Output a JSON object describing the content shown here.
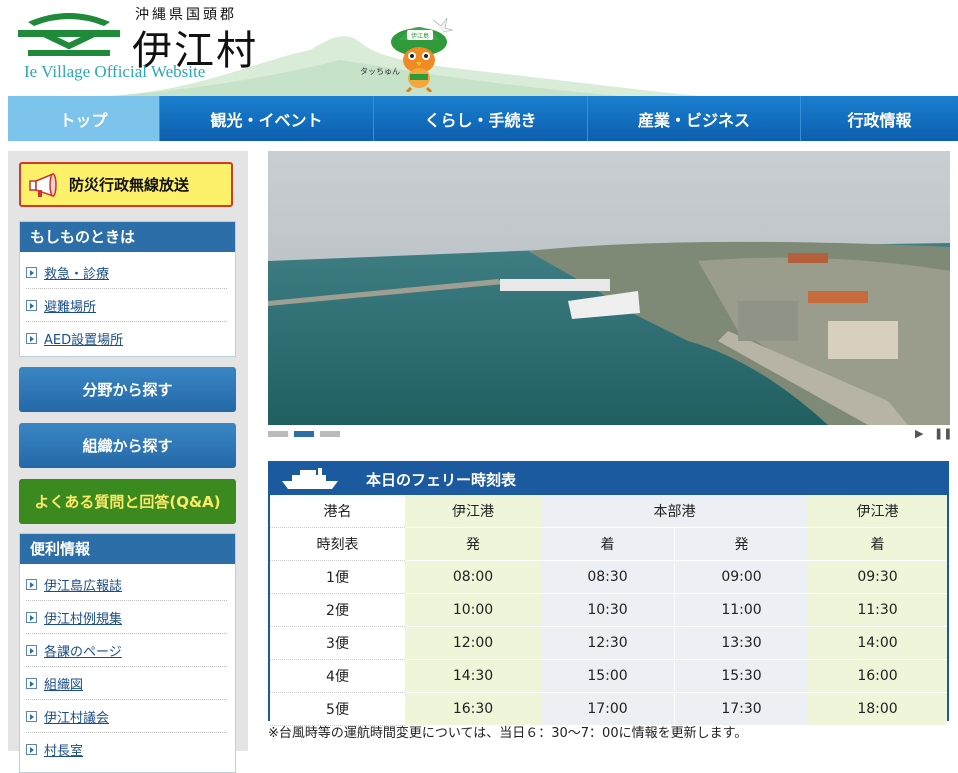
{
  "header": {
    "prefecture_line": "沖縄県国頭郡",
    "village_name": "伊江村",
    "site_subtitle": "Ie Village Official Website",
    "mascot_name": "タッちゅん",
    "mascot_hat_text": "伊江島"
  },
  "nav": {
    "items": [
      {
        "label": "トップ"
      },
      {
        "label": "観光・イベント"
      },
      {
        "label": "くらし・手続き"
      },
      {
        "label": "産業・ビジネス"
      },
      {
        "label": "行政情報"
      }
    ]
  },
  "sidebar": {
    "disaster_button": "防災行政無線放送",
    "emergency": {
      "title": "もしものときは",
      "links": [
        "救急・診療",
        "避難場所",
        "AED設置場所"
      ]
    },
    "search_by_field": "分野から探す",
    "search_by_org": "組織から探す",
    "faq": "よくある質問と回答(Q&A)",
    "useful": {
      "title": "便利情報",
      "links": [
        "伊江島広報誌",
        "伊江村例規集",
        "各課のページ",
        "組織図",
        "伊江村議会",
        "村長室"
      ]
    }
  },
  "slider": {
    "dots": 3,
    "active_dot": 1,
    "play_icon": "▶",
    "pause_icon": "⏸"
  },
  "ferry": {
    "title": "本日のフェリー時刻表",
    "header_row": {
      "label": "港名",
      "port1": "伊江港",
      "port2": "本部港",
      "port3": "伊江港"
    },
    "sub_row": {
      "label": "時刻表",
      "c1": "発",
      "c2": "着",
      "c3": "発",
      "c4": "着"
    },
    "rows": [
      {
        "name": "1便",
        "t1": "08:00",
        "t2": "08:30",
        "t3": "09:00",
        "t4": "09:30"
      },
      {
        "name": "2便",
        "t1": "10:00",
        "t2": "10:30",
        "t3": "11:00",
        "t4": "11:30"
      },
      {
        "name": "3便",
        "t1": "12:00",
        "t2": "12:30",
        "t3": "13:30",
        "t4": "14:00"
      },
      {
        "name": "4便",
        "t1": "14:30",
        "t2": "15:00",
        "t3": "15:30",
        "t4": "16:00"
      },
      {
        "name": "5便",
        "t1": "16:30",
        "t2": "17:00",
        "t3": "17:30",
        "t4": "18:00"
      }
    ],
    "note": "※台風時等の運航時間変更については、当日６：30〜7：00に情報を更新します。"
  },
  "colors": {
    "nav_blue": "#0d5fae",
    "nav_active": "#7cc4ec",
    "panel_blue": "#2b6ea8",
    "faq_green": "#3a8a1f",
    "alert_yellow": "#fdf06a",
    "alert_red": "#d23a2a"
  }
}
